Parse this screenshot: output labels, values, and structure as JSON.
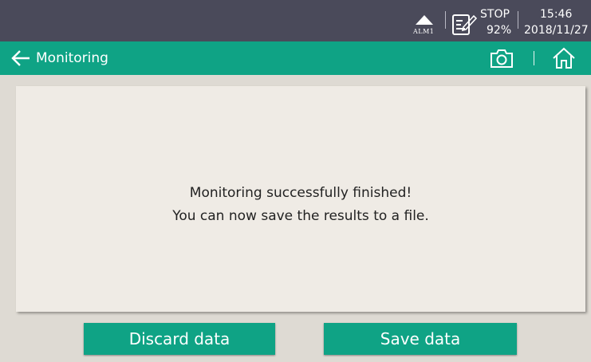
{
  "status_bar": {
    "alarm_label": "ALM1",
    "mode": "STOP",
    "battery": "92%",
    "time": "15:46",
    "date": "2018/11/27"
  },
  "nav": {
    "title": "Monitoring",
    "back_icon": "arrow-left-icon",
    "camera_icon": "camera-icon",
    "home_icon": "home-icon"
  },
  "message": {
    "line1": "Monitoring successfully finished!",
    "line2": "You can now save the results to a file."
  },
  "actions": {
    "discard_label": "Discard data",
    "save_label": "Save data"
  },
  "colors": {
    "accent": "#0fa385",
    "status_bar": "#4a4a5a",
    "background": "#dedad3",
    "panel": "#efebe5"
  }
}
